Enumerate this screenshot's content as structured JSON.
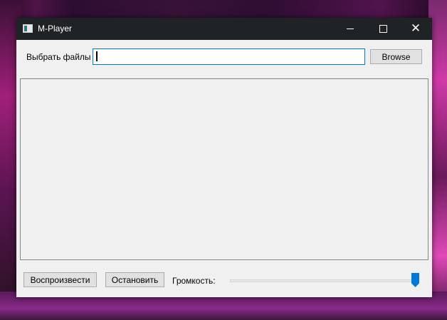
{
  "window": {
    "title": "M-Player"
  },
  "file_picker": {
    "label": "Выбрать файлы",
    "value": "",
    "browse_label": "Browse"
  },
  "playlist": {
    "items": []
  },
  "controls": {
    "play_label": "Воспроизвести",
    "stop_label": "Остановить",
    "volume_label": "Громкость:",
    "volume_level": 1.0
  },
  "colors": {
    "accent": "#0078d7",
    "titlebar": "#202326"
  },
  "icons": {
    "app": "app-window-icon",
    "minimize": "minimize-icon",
    "maximize": "maximize-icon",
    "close": "close-icon"
  }
}
